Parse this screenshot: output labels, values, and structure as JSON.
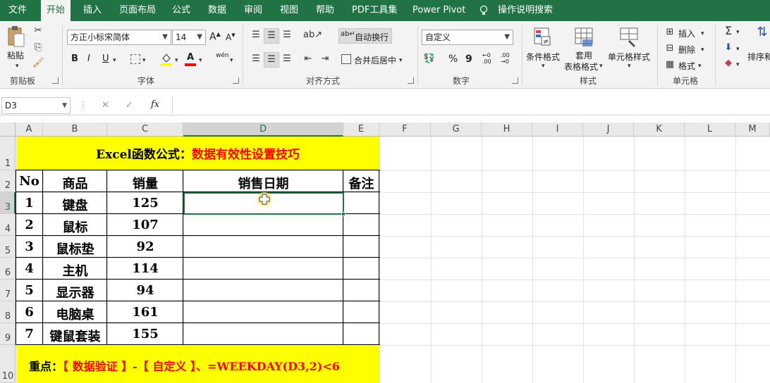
{
  "menu": {
    "items": [
      "文件",
      "开始",
      "插入",
      "页面布局",
      "公式",
      "数据",
      "审阅",
      "视图",
      "帮助",
      "PDF工具集",
      "Power Pivot",
      "操作说明搜索"
    ]
  },
  "ribbon": {
    "clipboard": {
      "paste_label": "粘贴",
      "group_label": "剪贴板"
    },
    "font": {
      "font_name": "方正小标宋简体",
      "font_size": "14",
      "bold": "B",
      "italic": "I",
      "underline": "U",
      "grow": "A",
      "shrink": "A",
      "font_color_glyph": "A",
      "phonetic": "wén",
      "group_label": "字体"
    },
    "alignment": {
      "wrap_text": "自动换行",
      "merge_center": "合并后居中",
      "group_label": "对齐方式"
    },
    "number": {
      "format": "自定义",
      "percent": "%",
      "comma": "9",
      "inc_decimal": "←0 .00",
      "dec_decimal": ".00 →0",
      "group_label": "数字"
    },
    "styles": {
      "conditional": "条件格式",
      "table_line1": "套用",
      "table_line2": "表格格式",
      "cell_styles": "单元格样式",
      "group_label": "样式"
    },
    "cells": {
      "insert": "插入",
      "delete": "删除",
      "format": "格式",
      "group_label": "单元格"
    },
    "editing": {
      "sort_filter": "排序和"
    }
  },
  "formula_bar": {
    "name_box": "D3",
    "fx": "fx",
    "cancel": "✕",
    "confirm": "✓",
    "value": ""
  },
  "grid": {
    "columns": [
      "A",
      "B",
      "C",
      "D",
      "E",
      "F",
      "G",
      "H",
      "I",
      "J",
      "K",
      "L",
      "M"
    ],
    "rows": [
      "1",
      "2",
      "3",
      "4",
      "5",
      "6",
      "7",
      "8",
      "9",
      "10"
    ],
    "selected_cell": "D3",
    "title_prefix": "Excel函数公式：",
    "title_highlight": "数据有效性设置技巧",
    "headers": [
      "No",
      "商品",
      "销量",
      "销售日期",
      "备注"
    ],
    "data": [
      [
        "1",
        "键盘",
        "125"
      ],
      [
        "2",
        "鼠标",
        "107"
      ],
      [
        "3",
        "鼠标垫",
        "92"
      ],
      [
        "4",
        "主机",
        "114"
      ],
      [
        "5",
        "显示器",
        "94"
      ],
      [
        "6",
        "电脑桌",
        "161"
      ],
      [
        "7",
        "键鼠套装",
        "155"
      ]
    ],
    "footer_prefix": "重点：",
    "footer_text": "【 数据验证 】-【 自定义 】、=WEEKDAY(D3,2)<6"
  },
  "colors": {
    "excel_green": "#217346",
    "yellow_fill": "#ffff00",
    "red_text": "#ff0000"
  }
}
